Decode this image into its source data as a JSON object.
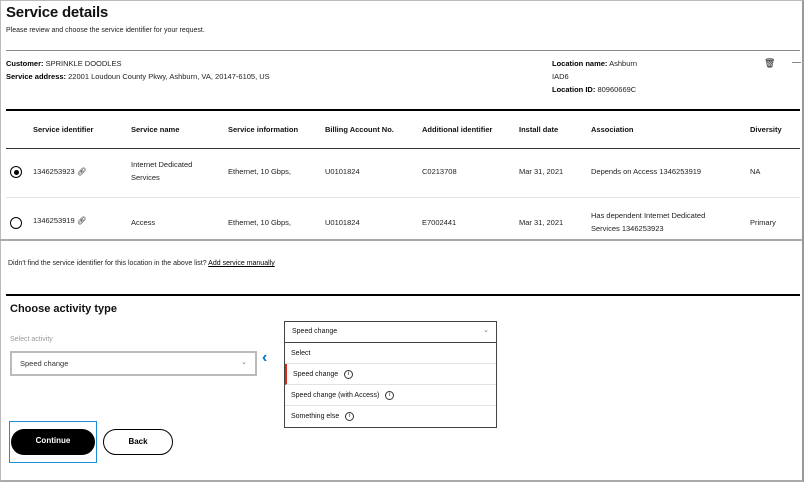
{
  "header": {
    "title": "Service details",
    "subtitle": "Please review and choose the service identifier for your request."
  },
  "customer": {
    "customer_label": "Customer:",
    "customer_value": "SPRINKLE DOODLES",
    "address_label": "Service address:",
    "address_value": "22001 Loudoun County Pkwy, Ashburn, VA, 20147-6105, US",
    "location_name_label": "Location name:",
    "location_name_value": "Ashburn",
    "location_code": "IAD6",
    "location_id_label": "Location ID:",
    "location_id_value": "80960669C"
  },
  "table": {
    "headers": [
      "Service identifier",
      "Service name",
      "Service information",
      "Billing Account No.",
      "Additional identifier",
      "Install date",
      "Association",
      "Diversity"
    ],
    "rows": [
      {
        "selected": true,
        "id": "1346253923",
        "name": [
          "Internet Dedicated",
          "Services"
        ],
        "info": "Ethernet, 10 Gbps,",
        "billing": "U0101824",
        "additional": "C0213708",
        "install": "Mar 31, 2021",
        "association": [
          "Depends on Access 1346253919"
        ],
        "diversity": "NA"
      },
      {
        "selected": false,
        "id": "1346253919",
        "name": [
          "Access"
        ],
        "info": "Ethernet, 10 Gbps,",
        "billing": "U0101824",
        "additional": "E7002441",
        "install": "Mar 31, 2021",
        "association": [
          "Has dependent Internet Dedicated",
          "Services 1346253923"
        ],
        "diversity": "Primary"
      }
    ]
  },
  "missing": {
    "text": "Didn't find the service identifier for this location in the above list?",
    "link": "Add service manually"
  },
  "activity": {
    "title": "Choose activity type",
    "label": "Select activity",
    "value": "Speed change",
    "dropdown": {
      "value": "Speed change",
      "options": [
        "Select",
        "Speed change",
        "Speed change (with Access)",
        "Something else"
      ]
    }
  },
  "buttons": {
    "continue": "Continue",
    "back": "Back"
  },
  "colors": {
    "accent": "#0077c8",
    "selected_marker": "#d52b1e"
  }
}
